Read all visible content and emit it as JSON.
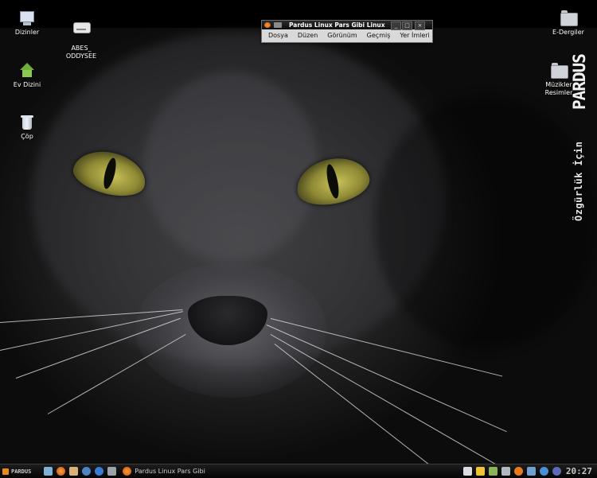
{
  "desktop": {
    "icons_left": [
      {
        "label": "Dizinler",
        "icon": "computer-icon"
      },
      {
        "label": "ABES_\nODDYSEE",
        "icon": "drive-icon"
      },
      {
        "label": "Ev Dizini",
        "icon": "home-icon"
      },
      {
        "label": "Çöp",
        "icon": "trash-icon"
      }
    ],
    "icons_right": [
      {
        "label": "E-Dergiler",
        "icon": "folder-icon"
      },
      {
        "label": "Müzikler Resimler",
        "icon": "folder-icon"
      }
    ]
  },
  "brand": {
    "logo_text": "PARDUS",
    "slogan": "Özgürlük İçin"
  },
  "window": {
    "title": "Pardus Linux Pars Gibi Linux",
    "menu": [
      "Dosya",
      "Düzen",
      "Görünüm",
      "Geçmiş",
      "Yer İmleri"
    ],
    "buttons": {
      "minimize": "_",
      "maximize": "□",
      "close": "×"
    }
  },
  "taskbar": {
    "start_label": "PARDUS",
    "launchers": [
      "network-icon",
      "firefox-icon",
      "users-icon",
      "konqueror-icon",
      "globe-icon",
      "monitor-icon"
    ],
    "task_label": "Pardus Linux Pars Gibi",
    "tray": [
      "clipboard-icon",
      "note-icon",
      "package-icon",
      "person-icon",
      "settings-icon",
      "display-icon",
      "network-tray-icon",
      "kde-icon"
    ],
    "clock": "20:27"
  },
  "colors": {
    "accent": "#e88a1a",
    "taskbar_bg": "#0d0d0d",
    "eye": "#c9c25a"
  }
}
